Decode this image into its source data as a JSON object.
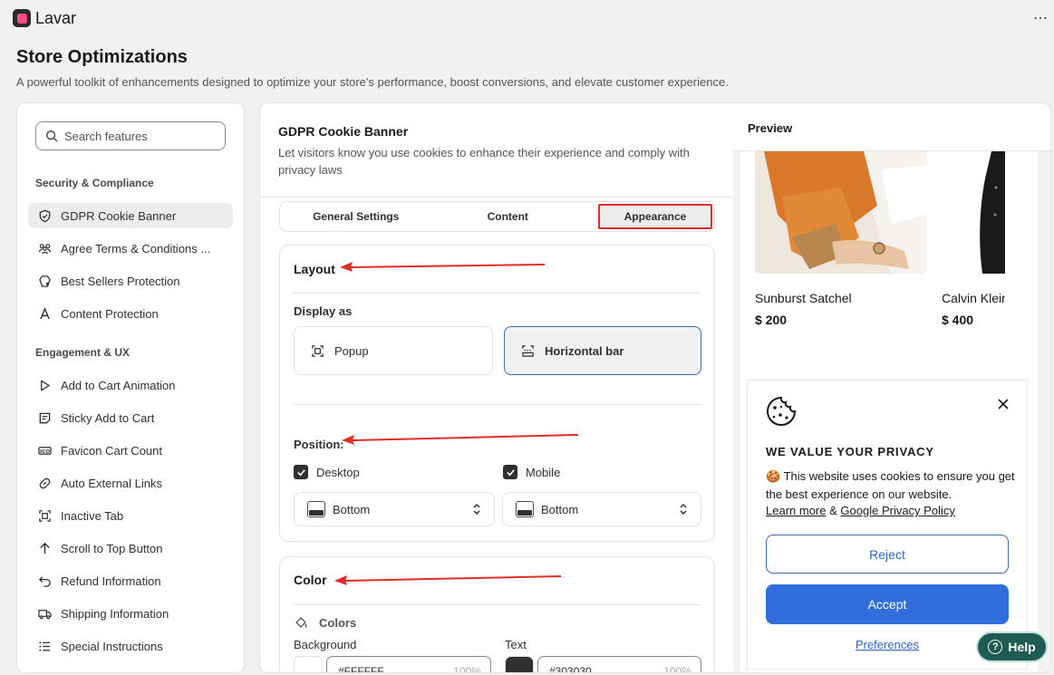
{
  "app": {
    "name": "Lavar"
  },
  "page": {
    "title": "Store Optimizations",
    "subtitle": "A powerful toolkit of enhancements designed to optimize your store's performance, boost conversions, and elevate customer experience."
  },
  "sidebar": {
    "search_placeholder": "Search features",
    "sections": [
      {
        "label": "Security & Compliance",
        "items": [
          {
            "label": "GDPR Cookie Banner",
            "icon": "shield-check-icon",
            "active": true
          },
          {
            "label": "Agree Terms & Conditions ...",
            "icon": "users-icon"
          },
          {
            "label": "Best Sellers Protection",
            "icon": "badge-icon"
          },
          {
            "label": "Content Protection",
            "icon": "text-icon"
          }
        ]
      },
      {
        "label": "Engagement & UX",
        "items": [
          {
            "label": "Add to Cart Animation",
            "icon": "play-icon"
          },
          {
            "label": "Sticky Add to Cart",
            "icon": "note-icon"
          },
          {
            "label": "Favicon Cart Count",
            "icon": "ico-icon"
          },
          {
            "label": "Auto External Links",
            "icon": "link-icon"
          },
          {
            "label": "Inactive Tab",
            "icon": "tab-icon"
          },
          {
            "label": "Scroll to Top Button",
            "icon": "arrow-up-icon"
          },
          {
            "label": "Refund Information",
            "icon": "undo-icon"
          },
          {
            "label": "Shipping Information",
            "icon": "truck-icon"
          },
          {
            "label": "Special Instructions",
            "icon": "list-icon"
          }
        ]
      }
    ]
  },
  "feature": {
    "title": "GDPR Cookie Banner",
    "description": "Let visitors know you use cookies to enhance their experience and comply with privacy laws",
    "tabs": [
      "General Settings",
      "Content",
      "Appearance"
    ],
    "active_tab": "Appearance"
  },
  "layout_panel": {
    "title": "Layout",
    "display_as_label": "Display as",
    "options": [
      {
        "label": "Popup",
        "icon": "popup-icon",
        "selected": false
      },
      {
        "label": "Horizontal bar",
        "icon": "horizontal-bar-icon",
        "selected": true
      }
    ],
    "position_label": "Position:",
    "desktop": {
      "label": "Desktop",
      "checked": true,
      "value": "Bottom"
    },
    "mobile": {
      "label": "Mobile",
      "checked": true,
      "value": "Bottom"
    }
  },
  "color_panel": {
    "title": "Color",
    "colors_label": "Colors",
    "background": {
      "label": "Background",
      "hex": "#FFFFFF",
      "opacity": "100%",
      "swatch": "#FFFFFF"
    },
    "text": {
      "label": "Text",
      "hex": "#303030",
      "opacity": "100%",
      "swatch": "#303030"
    }
  },
  "preview": {
    "label": "Preview",
    "products": [
      {
        "name": "Sunburst Satchel",
        "price": "$ 200"
      },
      {
        "name": "Calvin Klein",
        "price": "$ 400"
      }
    ],
    "banner": {
      "heading": "WE VALUE YOUR PRIVACY",
      "message": "🍪 This website uses cookies to ensure you get the best experience on our website.",
      "learn_more": "Learn more",
      "amp": "&",
      "privacy_link": "Google Privacy Policy",
      "reject": "Reject",
      "accept": "Accept",
      "preferences": "Preferences"
    }
  },
  "help": {
    "label": "Help"
  },
  "colors": {
    "accent": "#2f6fdc",
    "annotation_red": "#e02e24",
    "help_bg": "#1e5b52"
  }
}
